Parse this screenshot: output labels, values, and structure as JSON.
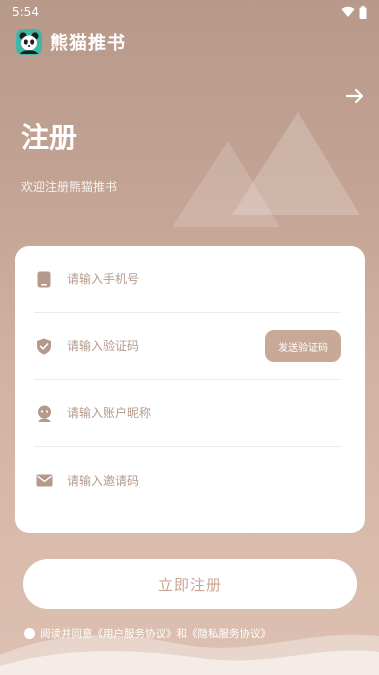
{
  "status_bar": {
    "time": "5:54"
  },
  "app": {
    "name": "熊猫推书"
  },
  "page": {
    "title": "注册",
    "subtitle": "欢迎注册熊猫推书"
  },
  "form": {
    "phone": {
      "placeholder": "请输入手机号",
      "value": ""
    },
    "code": {
      "placeholder": "请输入验证码",
      "value": "",
      "send_label": "发送验证码"
    },
    "nickname": {
      "placeholder": "请输入账户昵称",
      "value": ""
    },
    "invite": {
      "placeholder": "请输入邀请码",
      "value": ""
    }
  },
  "register_button": {
    "label": "立即注册"
  },
  "agreement": {
    "prefix": "阅读并同意",
    "user_agreement": "《用户服务协议》",
    "conjunction": "和",
    "privacy_policy": "《隐私服务协议》"
  },
  "icons": {
    "wifi": "wifi-icon",
    "battery": "battery-icon",
    "logo": "panda-logo-icon",
    "arrow": "arrow-right-icon",
    "phone": "phone-icon",
    "shield": "shield-check-icon",
    "user": "user-icon",
    "mail": "mail-icon"
  },
  "colors": {
    "accent": "#c8a897",
    "button_text": "#c9a593",
    "field_icon": "#b59a8c",
    "background_top": "#b7998a",
    "background_bottom": "#dcc0b1"
  }
}
